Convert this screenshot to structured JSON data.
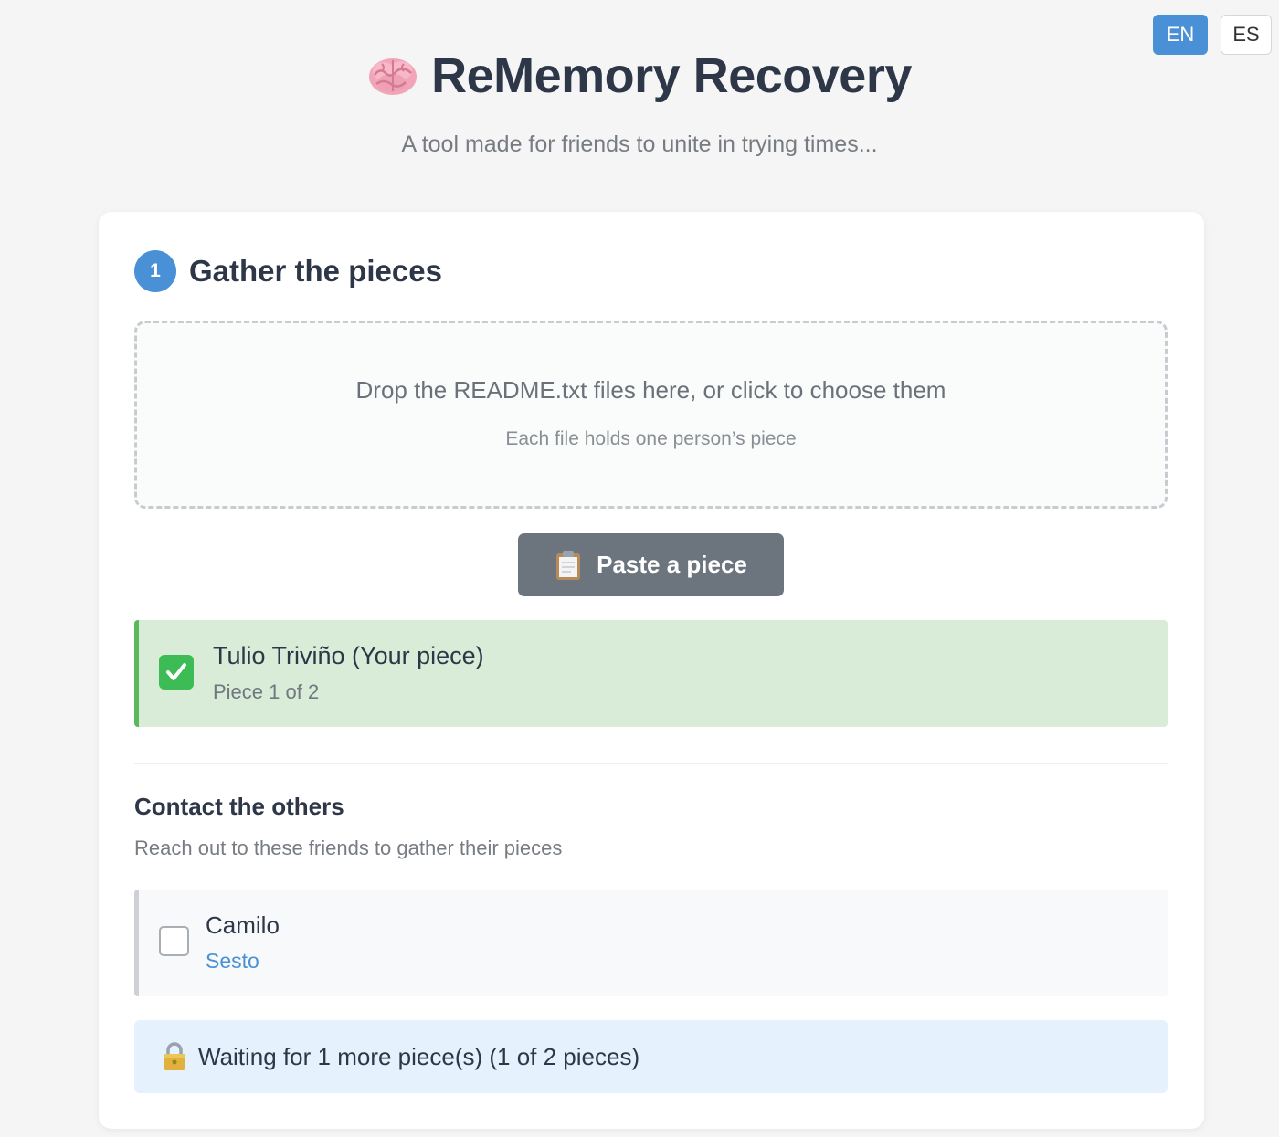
{
  "language": {
    "options": [
      {
        "label": "EN",
        "active": true
      },
      {
        "label": "ES",
        "active": false
      }
    ]
  },
  "header": {
    "title": "ReMemory Recovery",
    "title_icon": "brain-icon",
    "subtitle": "A tool made for friends to unite in trying times..."
  },
  "step": {
    "number": "1",
    "title": "Gather the pieces"
  },
  "dropzone": {
    "main_text": "Drop the README.txt files here, or click to choose them",
    "sub_text": "Each file holds one person’s piece"
  },
  "paste_button": {
    "label": "Paste a piece",
    "icon": "clipboard-icon"
  },
  "pieces": [
    {
      "name": "Tulio Triviño (Your piece)",
      "detail": "Piece 1 of 2",
      "icon": "check-mark-icon"
    }
  ],
  "contacts": {
    "title": "Contact the others",
    "subtitle": "Reach out to these friends to gather their pieces",
    "items": [
      {
        "name": "Camilo",
        "detail": "Sesto",
        "checked": false
      }
    ]
  },
  "status": {
    "icon": "lock-icon",
    "text": "Waiting for 1 more piece(s) (1 of 2 pieces)"
  },
  "colors": {
    "accent": "#4a90d6",
    "success": "#5cb85c",
    "success_bg": "#d9ecd7",
    "info_bg": "#e5f1fc",
    "button_gray": "#6c757d"
  }
}
